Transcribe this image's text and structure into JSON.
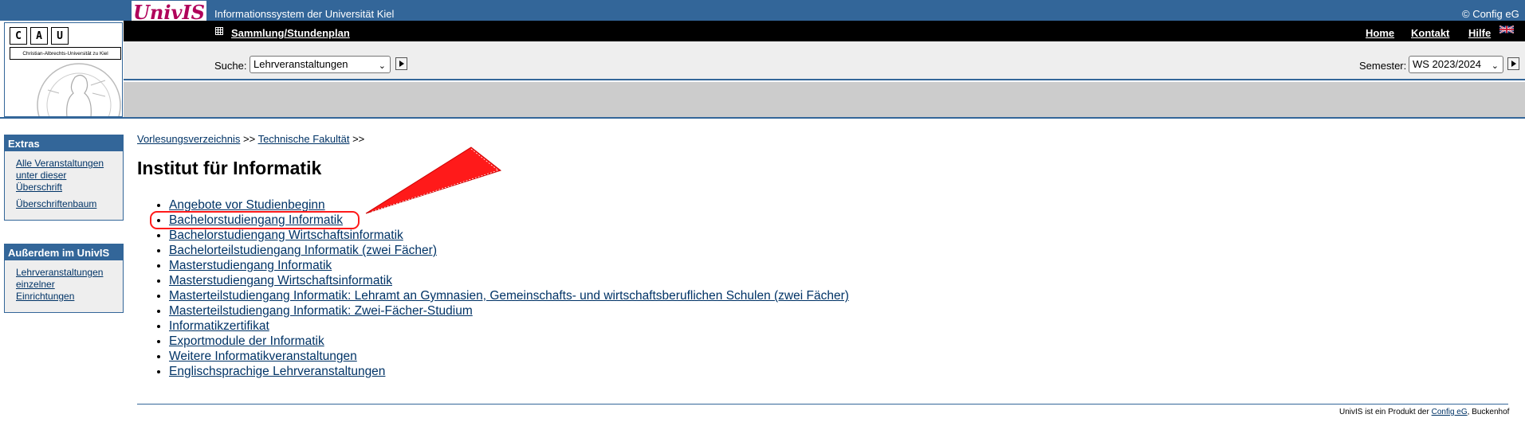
{
  "header": {
    "logo_text": "UnivIS",
    "system_title": "Informationssystem der Universität Kiel",
    "copyright": "© Config eG",
    "cau_letters": [
      "C",
      "A",
      "U"
    ],
    "cau_name": "Christian-Albrechts-Universität zu Kiel",
    "collection_link": "Sammlung/Stundenplan",
    "nav": [
      "Home",
      "Kontakt",
      "Hilfe"
    ],
    "language_icon": "uk-flag-icon"
  },
  "search": {
    "label": "Suche:",
    "selected": "Lehrveranstaltungen",
    "semester_label": "Semester:",
    "semester_selected": "WS 2023/2024"
  },
  "sidebar": {
    "extras_title": "Extras",
    "extras_links": [
      "Alle Veranstaltungen unter dieser Überschrift",
      "Überschriftenbaum"
    ],
    "also_title": "Außerdem im UnivIS",
    "also_links": [
      "Lehrveranstaltungen einzelner Einrichtungen"
    ]
  },
  "breadcrumb": {
    "items": [
      "Vorlesungsverzeichnis",
      "Technische Fakultät"
    ],
    "separator": ">>"
  },
  "main": {
    "title": "Institut für Informatik",
    "programs": [
      "Angebote vor Studienbeginn",
      "Bachelorstudiengang Informatik",
      "Bachelorstudiengang Wirtschaftsinformatik",
      "Bachelorteilstudiengang Informatik (zwei Fächer)",
      "Masterstudiengang Informatik",
      "Masterstudiengang Wirtschaftsinformatik",
      "Masterteilstudiengang Informatik: Lehramt an Gymnasien, Gemeinschafts- und wirtschaftsberuflichen Schulen (zwei Fächer)",
      "Masterteilstudiengang Informatik: Zwei-Fächer-Studium",
      "Informatikzertifikat",
      "Exportmodule der Informatik",
      "Weitere Informatikveranstaltungen",
      "Englischsprachige Lehrveranstaltungen"
    ],
    "highlighted_program": "Bachelorstudiengang Informatik"
  },
  "footer": {
    "prefix": "UnivIS ist ein Produkt der ",
    "link": "Config eG",
    "suffix": ", Buckenhof"
  },
  "colors": {
    "header_blue": "#336699",
    "logo_magenta": "#b0005a",
    "annotation_red": "#ff1a1a",
    "link": "#003366"
  }
}
